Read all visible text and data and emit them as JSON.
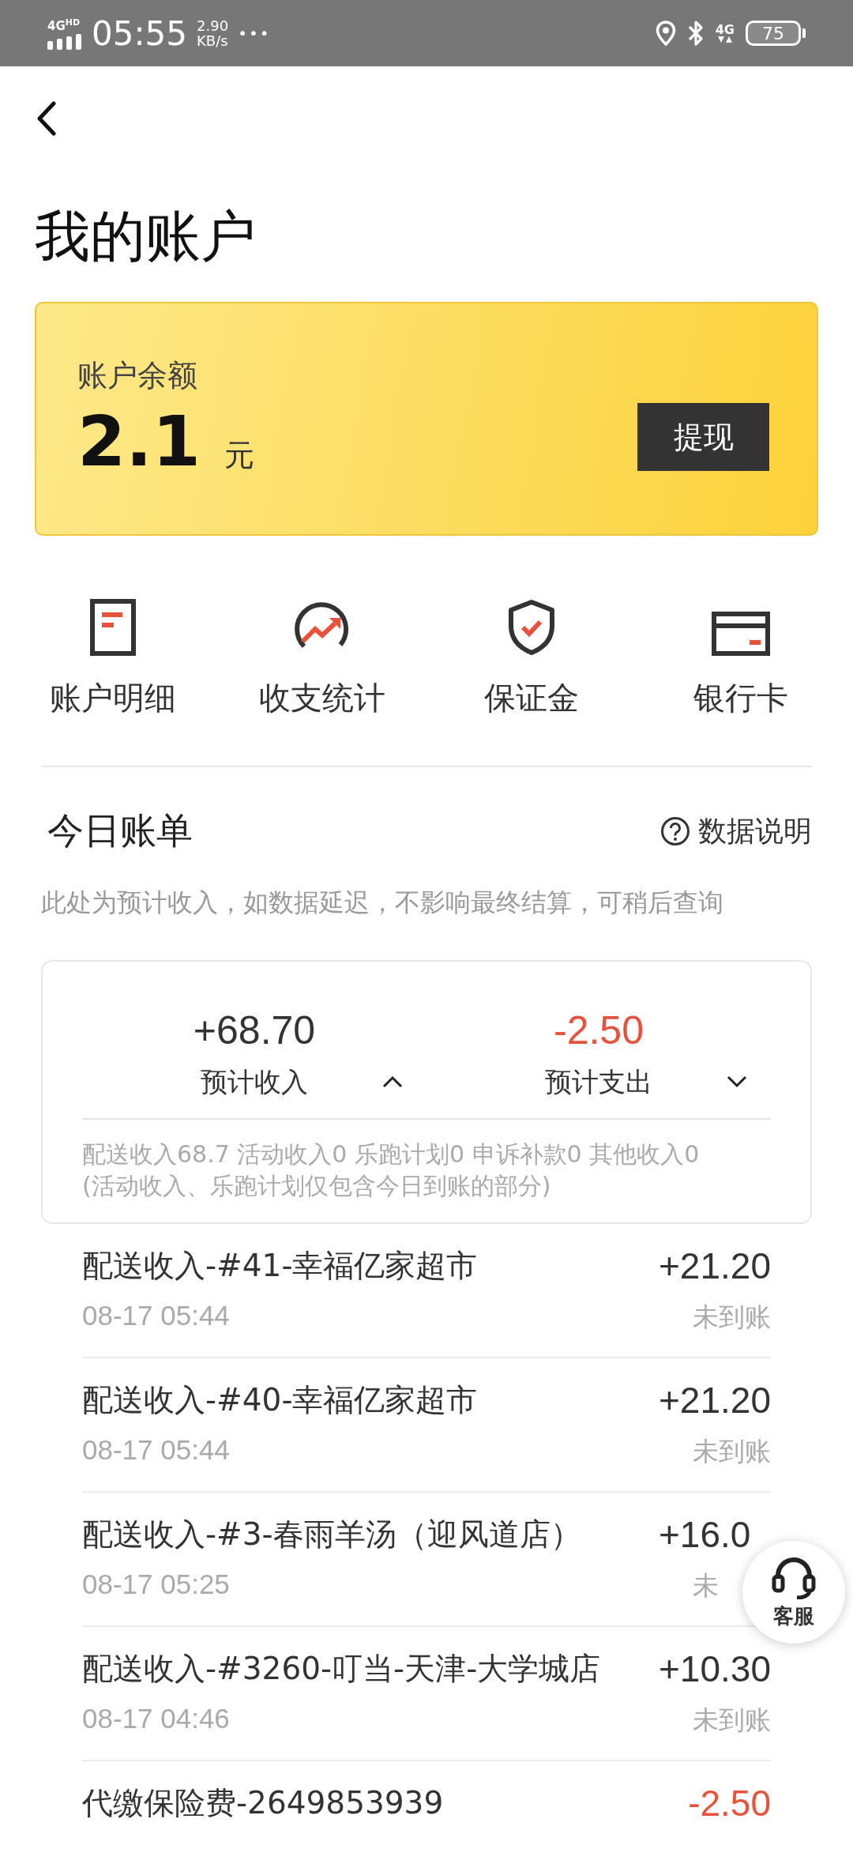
{
  "status_bar": {
    "network": "4G",
    "network_badge": "HD",
    "time": "05:55",
    "speed_value": "2.90",
    "speed_unit": "KB/s",
    "more": "•••",
    "cell_badge": "4G",
    "battery": "75"
  },
  "header": {
    "title": "我的账户"
  },
  "balance_card": {
    "label": "账户余额",
    "amount": "2.1",
    "unit": "元",
    "button": "提现"
  },
  "shortcuts": [
    {
      "label": "账户明细"
    },
    {
      "label": "收支统计"
    },
    {
      "label": "保证金"
    },
    {
      "label": "银行卡"
    }
  ],
  "today": {
    "title": "今日账单",
    "help": "数据说明",
    "note": "此处为预计收入，如数据延迟，不影响最终结算，可稍后查询"
  },
  "summary": {
    "items": [
      {
        "kind": "income",
        "amount": "+68.70",
        "label": "预计收入",
        "expanded": true
      },
      {
        "kind": "expense",
        "amount": "-2.50",
        "label": "预计支出",
        "expanded": false
      }
    ],
    "details": [
      "配送收入68.7 活动收入0 乐跑计划0 申诉补款0 其他收入0",
      "(活动收入、乐跑计划仅包含今日到账的部分)"
    ]
  },
  "transactions": [
    {
      "kind": "income",
      "title": "配送收入-#41-幸福亿家超市",
      "time": "08-17 05:44",
      "amount": "+21.20",
      "status": "未到账"
    },
    {
      "kind": "income",
      "title": "配送收入-#40-幸福亿家超市",
      "time": "08-17 05:44",
      "amount": "+21.20",
      "status": "未到账"
    },
    {
      "kind": "income",
      "title": "配送收入-#3-春雨羊汤（迎风道店）",
      "time": "08-17 05:25",
      "amount": "+16.0",
      "status": "未"
    },
    {
      "kind": "income",
      "title": "配送收入-#3260-叮当-天津-大学城店",
      "time": "08-17 04:46",
      "amount": "+10.30",
      "status": "未到账"
    },
    {
      "kind": "expense",
      "title": "代缴保险费-2649853939",
      "amount": "-2.50"
    }
  ],
  "float_button": {
    "label": "客服"
  }
}
